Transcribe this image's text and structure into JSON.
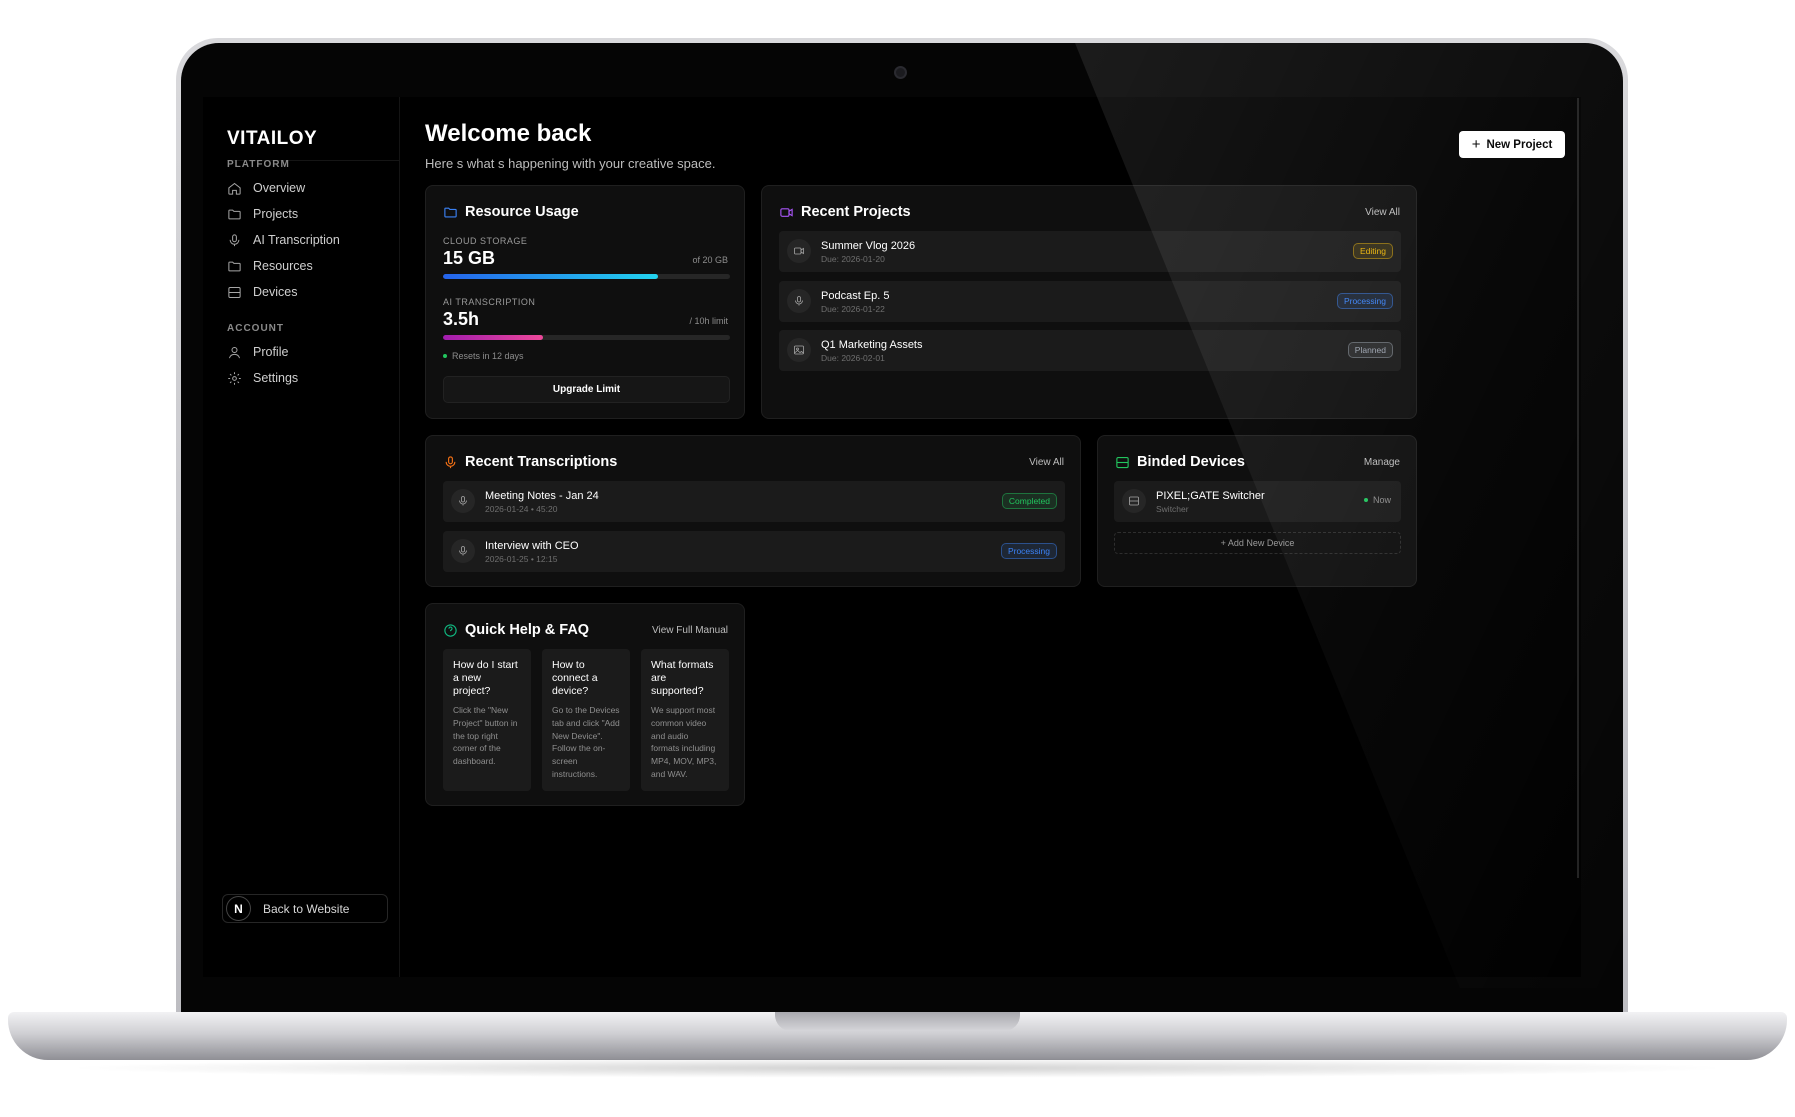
{
  "sidebar": {
    "brand": "VITAILOY",
    "platform_label": "PLATFORM",
    "platform_items": [
      {
        "label": "Overview",
        "icon": "home-icon"
      },
      {
        "label": "Projects",
        "icon": "folder-icon"
      },
      {
        "label": "AI Transcription",
        "icon": "mic-icon"
      },
      {
        "label": "Resources",
        "icon": "folder-icon"
      },
      {
        "label": "Devices",
        "icon": "server-icon"
      }
    ],
    "account_label": "ACCOUNT",
    "account_items": [
      {
        "label": "Profile",
        "icon": "user-icon"
      },
      {
        "label": "Settings",
        "icon": "gear-icon"
      }
    ],
    "back_avatar": "N",
    "back_label": "Back to Website"
  },
  "header": {
    "title": "Welcome back",
    "subtitle": "Here s what s happening with your creative space.",
    "new_project_label": "New Project"
  },
  "resource_usage": {
    "title": "Resource Usage",
    "storage_label": "CLOUD STORAGE",
    "storage_value": "15 GB",
    "storage_limit": "of 20 GB",
    "storage_fraction": 0.75,
    "transcription_label": "AI TRANSCRIPTION",
    "transcription_value": "3.5h",
    "transcription_limit": "/ 10h limit",
    "transcription_fraction": 0.35,
    "reset_text": "Resets in 12 days",
    "upgrade_label": "Upgrade Limit"
  },
  "recent_projects": {
    "title": "Recent Projects",
    "view_all": "View All",
    "items": [
      {
        "name": "Summer Vlog 2026",
        "due": "Due: 2026-01-20",
        "status": "Editing",
        "icon": "video-icon"
      },
      {
        "name": "Podcast Ep. 5",
        "due": "Due: 2026-01-22",
        "status": "Processing",
        "icon": "mic-icon"
      },
      {
        "name": "Q1 Marketing Assets",
        "due": "Due: 2026-02-01",
        "status": "Planned",
        "icon": "image-icon"
      }
    ]
  },
  "recent_transcriptions": {
    "title": "Recent Transcriptions",
    "view_all": "View All",
    "items": [
      {
        "name": "Meeting Notes - Jan 24",
        "meta": "2026-01-24 • 45:20",
        "status": "Completed"
      },
      {
        "name": "Interview with CEO",
        "meta": "2026-01-25 • 12:15",
        "status": "Processing"
      }
    ]
  },
  "binded_devices": {
    "title": "Binded Devices",
    "manage": "Manage",
    "device_name": "PIXEL;GATE Switcher",
    "device_type": "Switcher",
    "device_status": "Now",
    "add_label": "+ Add New Device"
  },
  "faq": {
    "title": "Quick Help & FAQ",
    "manual_link": "View Full Manual",
    "items": [
      {
        "q": "How do I start a new project?",
        "a": "Click the \"New Project\" button in the top right corner of the dashboard."
      },
      {
        "q": "How to connect a device?",
        "a": "Go to the Devices tab and click \"Add New Device\". Follow the on-screen instructions."
      },
      {
        "q": "What formats are supported?",
        "a": "We support most common video and audio formats including MP4, MOV, MP3, and WAV."
      }
    ]
  },
  "colors": {
    "editing": "#eab308",
    "processing": "#3b82f6",
    "completed": "#22c55e",
    "planned": "#9ca3af",
    "storage_bar_start": "#2563eb",
    "storage_bar_end": "#22d3ee",
    "transcription_bar_start": "#a21caf",
    "transcription_bar_end": "#ec4899"
  }
}
